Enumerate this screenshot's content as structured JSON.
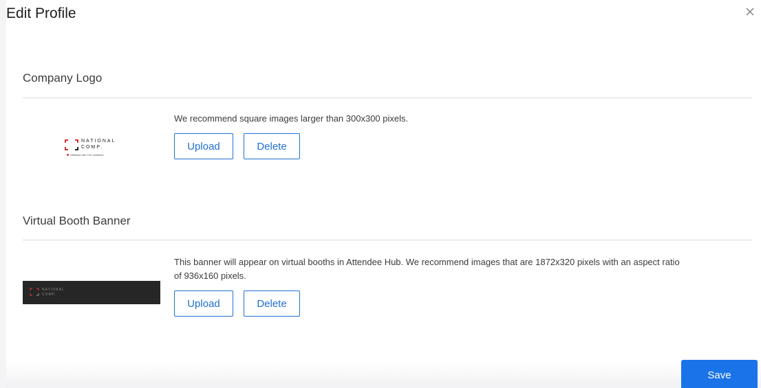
{
  "modal": {
    "title": "Edit Profile"
  },
  "company_logo": {
    "heading": "Company Logo",
    "hint": "We recommend square images larger than 300x300 pixels.",
    "upload_label": "Upload",
    "delete_label": "Delete",
    "image": {
      "line1": "NATIONAL",
      "line2": "COMP.",
      "tagline": "Affiliated with The Institutes"
    }
  },
  "booth_banner": {
    "heading": "Virtual Booth Banner",
    "hint_line1": "This banner will appear on virtual booths in Attendee Hub. We recommend images that are 1872x320 pixels with an aspect ratio",
    "hint_line2": "of 936x160 pixels.",
    "upload_label": "Upload",
    "delete_label": "Delete",
    "image": {
      "line1": "NATIONAL",
      "line2": "COMP."
    }
  },
  "footer": {
    "save_label": "Save"
  },
  "colors": {
    "accent": "#1a73e8",
    "button_outline": "#1f6fd1",
    "brand_red": "#d33333",
    "banner_bg": "#262626"
  },
  "icons": {
    "close": "close-icon",
    "logo_mark": "logo-bracket-icon"
  }
}
